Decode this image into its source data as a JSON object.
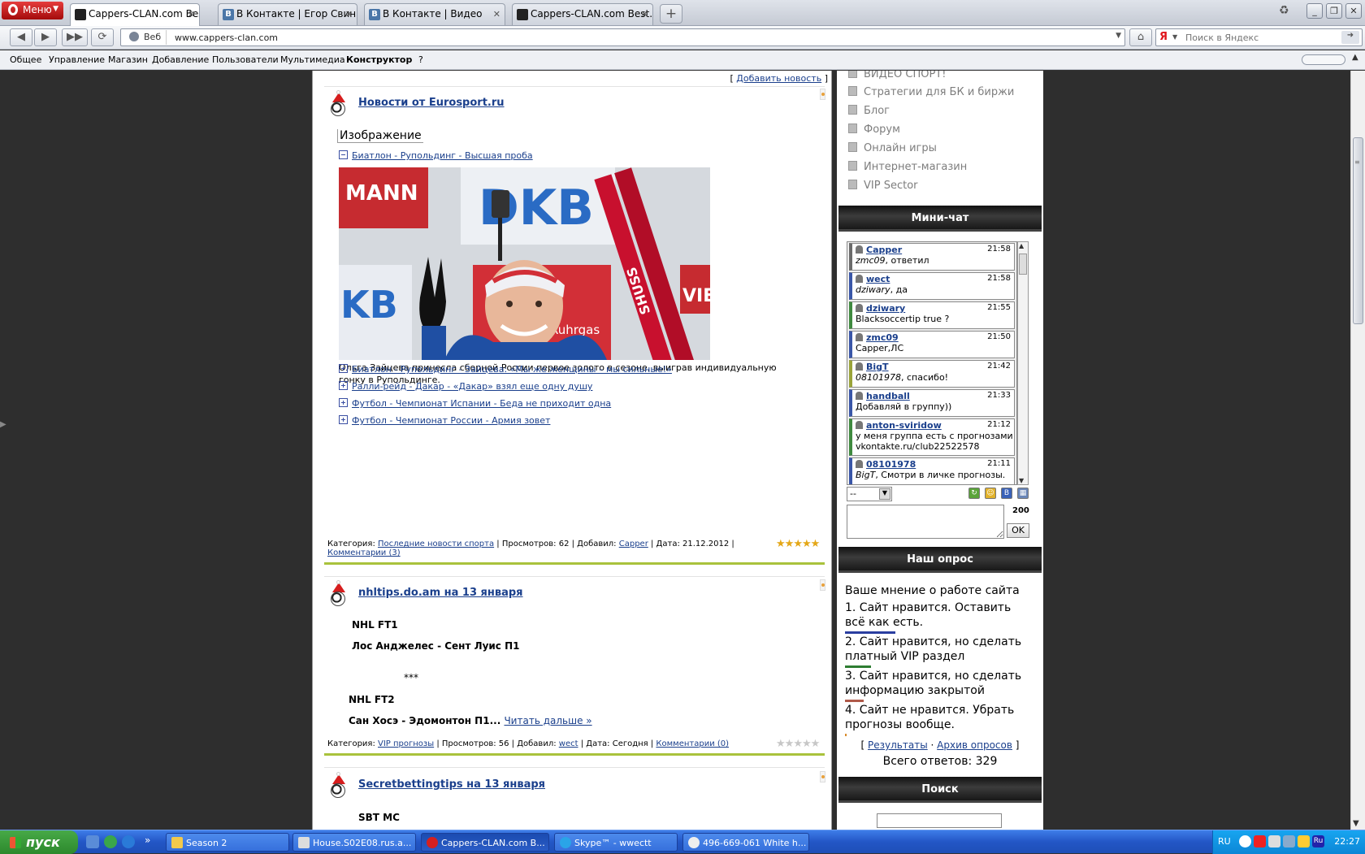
{
  "browser": {
    "menu_label": "Меню",
    "tabs": [
      {
        "title": "Cappers-CLAN.com Best...",
        "icon": "cappers-favicon",
        "active": true
      },
      {
        "title": "В Контакте | Егор Свин...",
        "icon": "vk-favicon"
      },
      {
        "title": "В Контакте | Видео",
        "icon": "vk-favicon"
      },
      {
        "title": "Cappers-CLAN.com Best...",
        "icon": "cappers-favicon"
      }
    ],
    "vk_letter": "B",
    "address_mode": "Веб",
    "url": "www.cappers-clan.com",
    "search_placeholder": "Поиск в Яндекс",
    "yandex_letter": "Я"
  },
  "admin_menu": {
    "items": [
      "Общее",
      "Управление",
      "Магазин",
      "Добавление",
      "Пользователи",
      "Мультимедиа",
      "Конструктор",
      "?"
    ]
  },
  "news": {
    "add_news": "Добавить новость",
    "add_news_brackets": [
      "[",
      "]"
    ],
    "items": [
      {
        "title": "Новости от Eurosport.ru",
        "image_label": "Изображение",
        "expanded_link": "Биатлон - Рупольдинг - Высшая проба",
        "photo_texts": [
          "MANN",
          "DKB",
          "KB",
          "Ruhrgas",
          "VIE",
          "SHUSS"
        ],
        "caption": "Ольга Зайцева принесла сборной России первое золото в сезоне, выиграв индивидуальную гонку в Рупольдинге.",
        "links": [
          "Биатлон - Рупольдинг - Зайцева: «Мы же женщины – мы сильные!»",
          "Ралли-рейд - Дакар - «Дакар» взял еще одну душу",
          "Футбол - Чемпионат Испании - Беда не приходит одна",
          "Футбол - Чемпионат России - Армия зовет"
        ],
        "meta": {
          "category_label": "Категория:",
          "category": "Последние новости спорта",
          "views": "| Просмотров: 62 | Добавил:",
          "author": "Capper",
          "date": "| Дата: 21.12.2012 |",
          "comments": "Комментарии (3)"
        },
        "rating": 5
      },
      {
        "title": "nhltips.do.am на 13 января",
        "lines": [
          "NHL FT1",
          "Лос Анджелес - Сент Луис П1",
          "***",
          "NHL FT2",
          "Сан Хосэ - Эдомонтон  П1..."
        ],
        "read_more": "Читать дальше »",
        "meta": {
          "category_label": "Категория:",
          "category": "VIP прогнозы",
          "views": "| Просмотров: 56 | Добавил:",
          "author": "wect",
          "date": "| Дата: Сегодня |",
          "comments": "Комментарии (0)"
        },
        "rating": 0
      },
      {
        "title": "Secretbettingtips на 13 января",
        "lines": [
          "SBT MC"
        ]
      }
    ]
  },
  "sidebar": {
    "menu": [
      "ВИДЕО СПОРТ!",
      "Стратегии для БК и биржи",
      "Блог",
      "Форум",
      "Онлайн игры",
      "Интернет-магазин",
      "VIP Sector"
    ],
    "minichat_title": "Мини-чат",
    "messages": [
      {
        "user": "Capper",
        "time": "21:58",
        "to": "zmc09",
        "text": ", ответил",
        "color": "#6b6b6b"
      },
      {
        "user": "wect",
        "time": "21:58",
        "to": "dziwary",
        "text": ", да",
        "color": "#3a56a8"
      },
      {
        "user": "dziwary",
        "time": "21:55",
        "to": "",
        "text": "Blacksoccertip true ?",
        "color": "#3f8a3f"
      },
      {
        "user": "zmc09",
        "time": "21:50",
        "to": "",
        "text": "Capper,ЛС",
        "color": "#3a56a8"
      },
      {
        "user": "BigT",
        "time": "21:42",
        "to": "08101978",
        "text": ", спасибо!",
        "color": "#9aa43a"
      },
      {
        "user": "handball",
        "time": "21:33",
        "to": "",
        "text": "Добавляй в группу))",
        "color": "#3a56a8"
      },
      {
        "user": "anton-sviridow",
        "time": "21:12",
        "to": "",
        "text": "у меня группа есть с прогнозами",
        "text2": "vkontakte.ru/club22522578",
        "color": "#3f8a3f"
      },
      {
        "user": "08101978",
        "time": "21:11",
        "to": "BigT",
        "text": ", Смотри в личке прогнозы.",
        "color": "#3a56a8"
      }
    ],
    "chat_select": "--",
    "chat_counter": "200",
    "chat_ok": "OK",
    "poll_title": "Наш опрос",
    "poll_question": "Ваше мнение о работе сайта",
    "poll_answers": [
      {
        "text": "1. Сайт нравится. Оставить всё как есть.",
        "color": "#2a3ea0",
        "share": 0.27
      },
      {
        "text": "2. Сайт нравится, но сделать платный VIP раздел",
        "color": "#2e7d32",
        "share": 0.14
      },
      {
        "text": "3. Сайт нравится, но сделать информацию закрытой",
        "color": "#b05a4a",
        "share": 0.1
      },
      {
        "text": "4. Сайт не нравится. Убрать прогнозы вообще.",
        "color": "#d88a2a",
        "share": 0.01
      }
    ],
    "poll_results": "Результаты",
    "poll_archive": "Архив опросов",
    "poll_link_dot": "·",
    "poll_brackets": [
      "[",
      "]"
    ],
    "poll_total_label": "Всего ответов:",
    "poll_total": "329",
    "search_title": "Поиск"
  },
  "taskbar": {
    "start": "пуск",
    "tasks": [
      {
        "title": "Season 2",
        "icon": "folder-icon"
      },
      {
        "title": "House.S02E08.rus.a...",
        "icon": "video-icon"
      },
      {
        "title": "Cappers-CLAN.com B...",
        "icon": "opera-icon",
        "active": true
      },
      {
        "title": "Skype™ - wwectt",
        "icon": "skype-icon"
      },
      {
        "title": "496-669-061 White h...",
        "icon": "chat-icon"
      }
    ],
    "lang": "RU",
    "lang_badge": "Ru",
    "clock": "22:27"
  }
}
